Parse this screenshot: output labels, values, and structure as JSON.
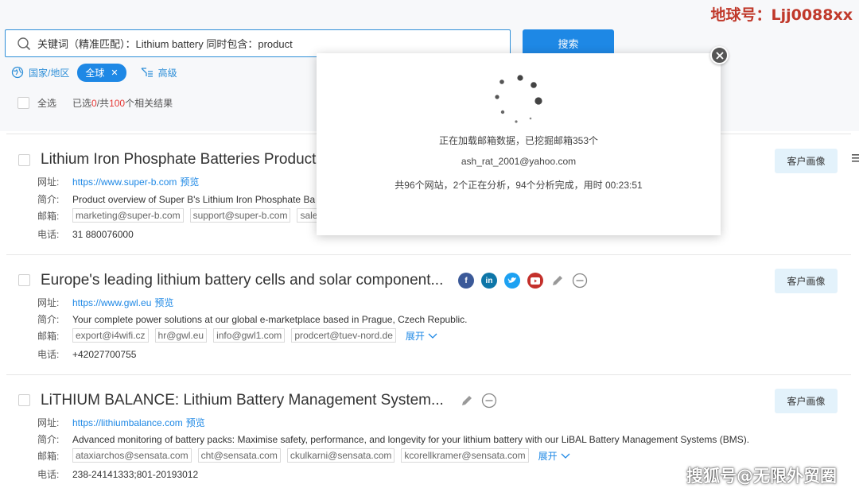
{
  "watermark_top": "地球号：Ljj0088xx",
  "watermark_bottom": "搜狐号@无限外贸圈",
  "search": {
    "query": "关键词（精准匹配）：Lithium battery  同时包含：product",
    "button_label": "搜索"
  },
  "filters": {
    "region_label": "国家/地区",
    "region_chip": "全球",
    "advanced_label": "高级"
  },
  "selection": {
    "select_all": "全选",
    "stat_prefix": "已选",
    "selected_count": "0",
    "stat_mid": "/共",
    "total_count": "100",
    "stat_suffix": "个相关结果"
  },
  "labels": {
    "website": "网址:",
    "intro": "简介:",
    "email": "邮箱:",
    "phone": "电话:",
    "preview": "预览",
    "expand": "展开",
    "portrait": "客户画像"
  },
  "results": [
    {
      "title": "Lithium Iron Phosphate Batteries Product",
      "url": "https://www.super-b.com",
      "intro": "Product overview of Super B's Lithium Iron Phosphate Ba",
      "emails": [
        "marketing@super-b.com",
        "support@super-b.com",
        "sale"
      ],
      "phone": "31 880076000"
    },
    {
      "title": "Europe's leading lithium battery cells and solar component...",
      "url": "https://www.gwl.eu",
      "intro": "Your complete power solutions at our global e-marketplace based in Prague, Czech Republic.",
      "emails": [
        "export@i4wifi.cz",
        "hr@gwl.eu",
        "info@gwl1.com",
        "prodcert@tuev-nord.de"
      ],
      "phone": "+42027700755",
      "icons": [
        "facebook-icon",
        "linkedin-icon",
        "twitter-icon",
        "youtube-icon",
        "edit-icon",
        "remove-icon"
      ]
    },
    {
      "title": "LiTHIUM BALANCE: Lithium Battery Management System...",
      "url": "https://lithiumbalance.com",
      "intro": "Advanced monitoring of battery packs: Maximise safety, performance, and longevity for your lithium battery with our LiBAL Battery Management Systems (BMS).",
      "emails": [
        "ataxiarchos@sensata.com",
        "cht@sensata.com",
        "ckulkarni@sensata.com",
        "kcorellkramer@sensata.com"
      ],
      "phone": "238-24141333;801-20193012",
      "icons": [
        "edit-icon",
        "remove-icon"
      ]
    }
  ],
  "modal": {
    "loading_text": "正在加载邮箱数据，已挖掘邮箱353个",
    "current_email": "ash_rat_2001@yahoo.com",
    "progress_text": "共96个网站，2个正在分析，94个分析完成，用时 00:23:51"
  },
  "colors": {
    "primary": "#1e88e5",
    "highlight_red": "#e53935",
    "portrait_bg": "#e3f2fb",
    "facebook": "#3b5998",
    "linkedin": "#0e76a8",
    "twitter": "#1da1f2",
    "youtube": "#c4302b"
  }
}
